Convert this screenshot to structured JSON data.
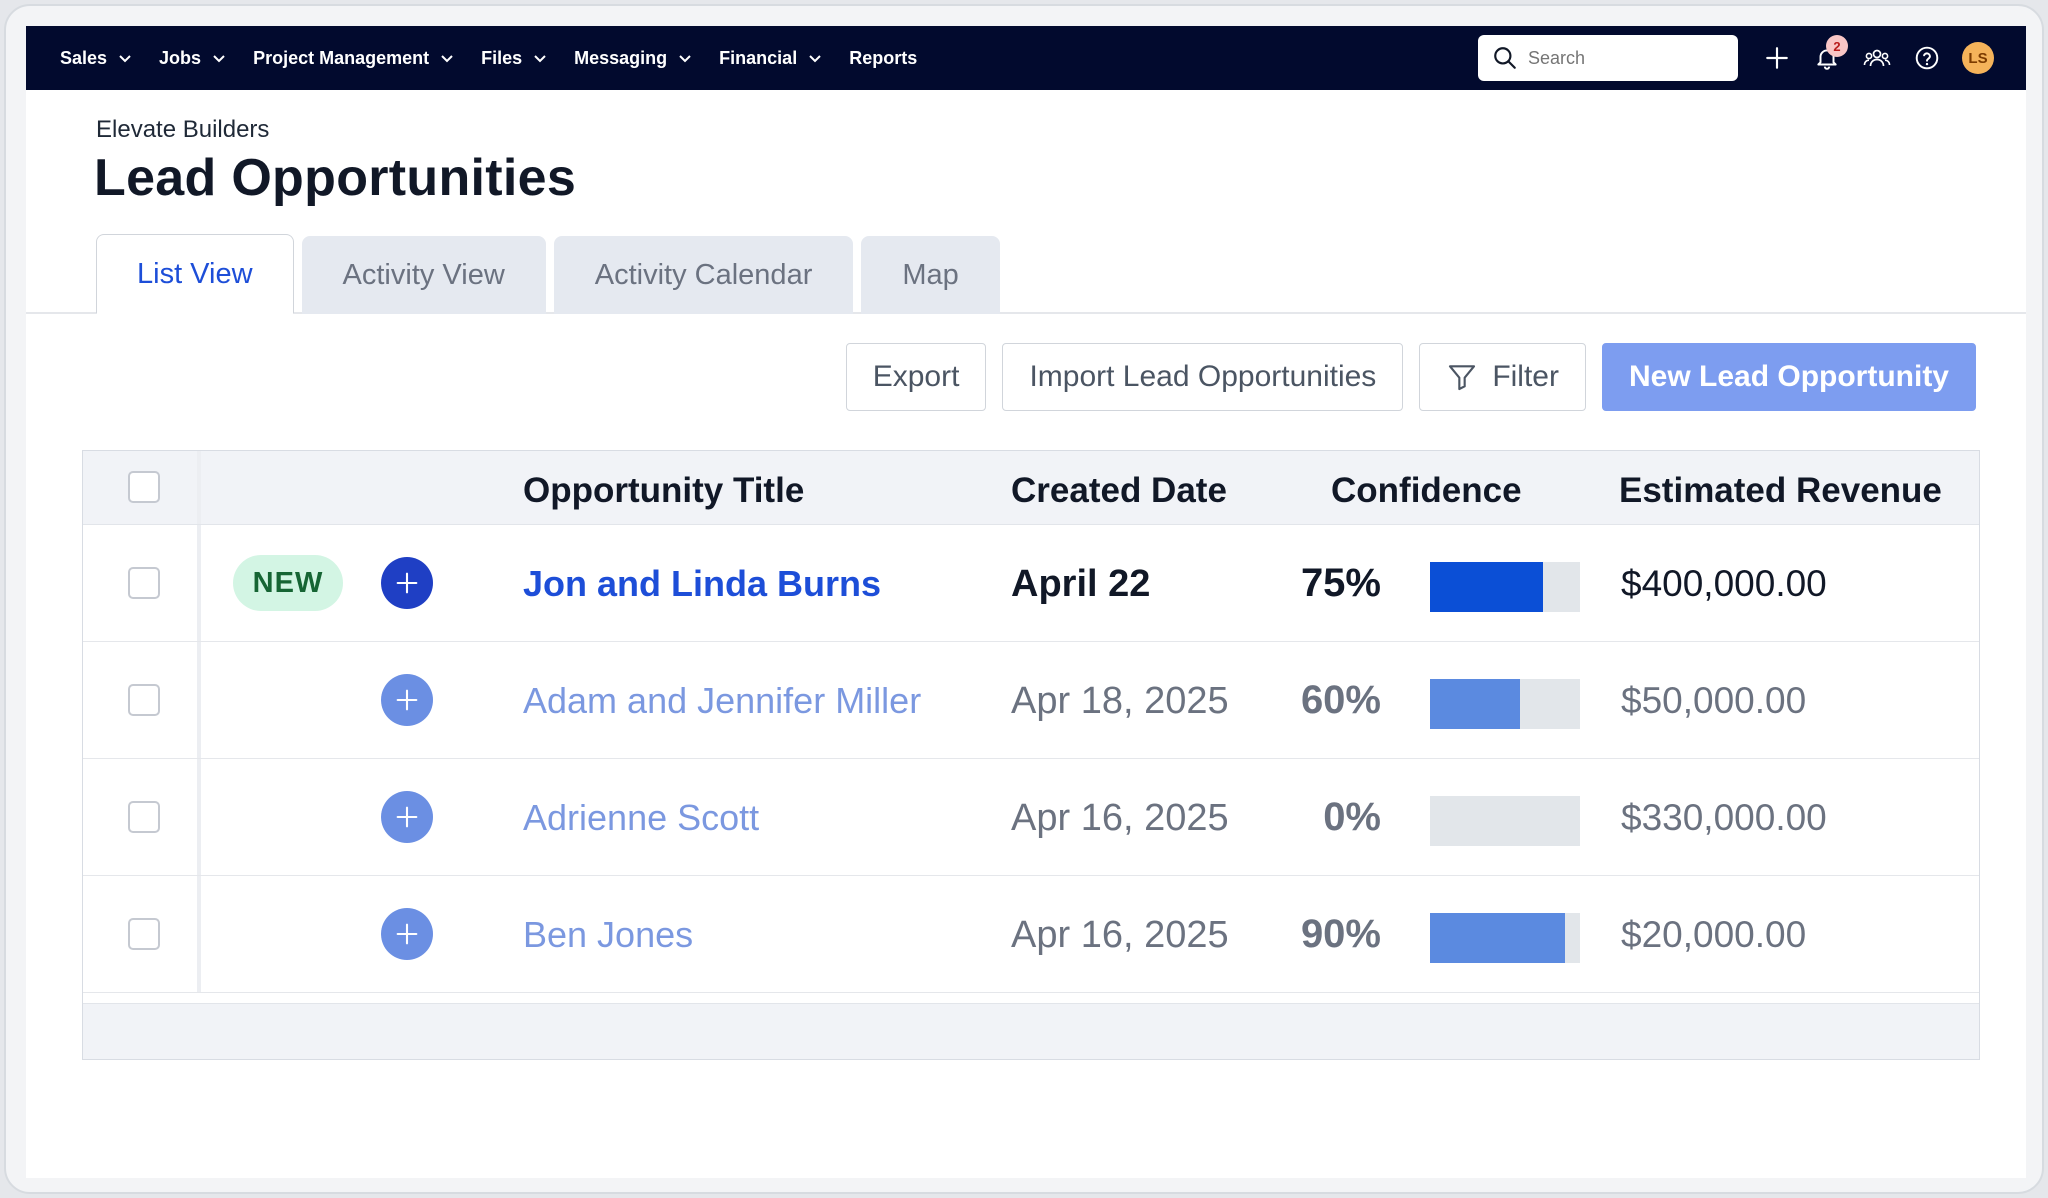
{
  "nav": {
    "items": [
      {
        "label": "Sales",
        "has_menu": true
      },
      {
        "label": "Jobs",
        "has_menu": true
      },
      {
        "label": "Project Management",
        "has_menu": true
      },
      {
        "label": "Files",
        "has_menu": true
      },
      {
        "label": "Messaging",
        "has_menu": true
      },
      {
        "label": "Financial",
        "has_menu": true
      },
      {
        "label": "Reports",
        "has_menu": false
      }
    ],
    "search_placeholder": "Search",
    "notification_count": "2",
    "avatar_initials": "LS",
    "icons": [
      "search-icon",
      "plus-icon",
      "bell-icon",
      "team-icon",
      "help-icon"
    ]
  },
  "header": {
    "company": "Elevate Builders",
    "title": "Lead Opportunities"
  },
  "tabs": [
    {
      "label": "List View",
      "active": true
    },
    {
      "label": "Activity View",
      "active": false
    },
    {
      "label": "Activity Calendar",
      "active": false
    },
    {
      "label": "Map",
      "active": false
    }
  ],
  "toolbar": {
    "export_label": "Export",
    "import_label": "Import Lead Opportunities",
    "filter_label": "Filter",
    "new_label": "New Lead Opportunity"
  },
  "table": {
    "columns": {
      "title": "Opportunity Title",
      "created": "Created Date",
      "confidence": "Confidence",
      "revenue": "Estimated Revenue"
    },
    "rows": [
      {
        "is_new": true,
        "new_label": "NEW",
        "title": "Jon and Linda Burns",
        "created": "April 22",
        "confidence": "75%",
        "confidence_value": 75,
        "revenue": "$400,000.00"
      },
      {
        "is_new": false,
        "title": "Adam and Jennifer Miller",
        "created": "Apr 18, 2025",
        "confidence": "60%",
        "confidence_value": 60,
        "revenue": "$50,000.00"
      },
      {
        "is_new": false,
        "title": "Adrienne Scott",
        "created": "Apr 16, 2025",
        "confidence": "0%",
        "confidence_value": 0,
        "revenue": "$330,000.00"
      },
      {
        "is_new": false,
        "title": "Ben Jones",
        "created": "Apr 16, 2025",
        "confidence": "90%",
        "confidence_value": 90,
        "revenue": "$20,000.00"
      }
    ]
  },
  "colors": {
    "nav_bg": "#020a2e",
    "link_strong": "#1d4ed8",
    "link_muted": "#7b98e0",
    "bar_strong": "#0b4fd6",
    "bar_muted": "#5b8ae0",
    "primary_button": "#7d9df0"
  }
}
